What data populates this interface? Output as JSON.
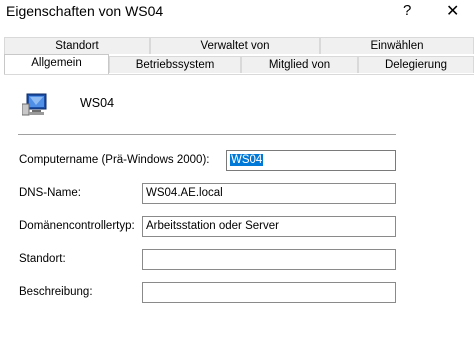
{
  "window": {
    "title": "Eigenschaften von WS04",
    "help_label": "?",
    "close_label": "✕"
  },
  "tabs": {
    "row1": [
      "Standort",
      "Verwaltet von",
      "Einwählen"
    ],
    "row2": [
      "Allgemein",
      "Betriebssystem",
      "Mitglied von",
      "Delegierung"
    ],
    "active": "Allgemein"
  },
  "general": {
    "icon": "computer-icon",
    "object_name": "WS04",
    "fields": {
      "computername_label": "Computername (Prä-Windows 2000):",
      "computername_value": "WS04",
      "dns_label": "DNS-Name:",
      "dns_value": "WS04.AE.local",
      "role_label": "Domänencontrollertyp:",
      "role_value": "Arbeitsstation oder Server",
      "site_label": "Standort:",
      "site_value": "",
      "description_label": "Beschreibung:",
      "description_value": ""
    }
  },
  "colors": {
    "selection": "#0078d7"
  }
}
